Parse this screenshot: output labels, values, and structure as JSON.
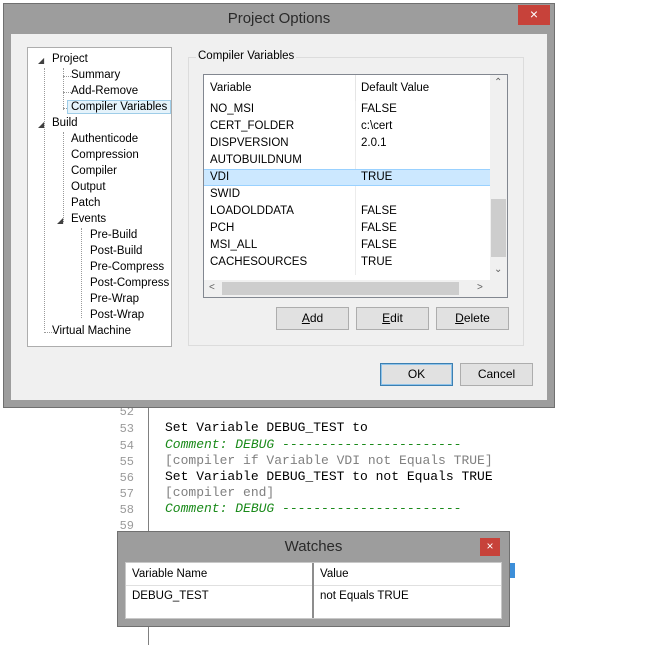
{
  "editor": {
    "lines": [
      {
        "num": "52",
        "text": ""
      },
      {
        "num": "53",
        "text": "Set Variable DEBUG_TEST to"
      },
      {
        "num": "54",
        "text": "Comment: DEBUG -----------------------"
      },
      {
        "num": "55",
        "text": "[compiler if Variable VDI not Equals TRUE]"
      },
      {
        "num": "56",
        "text": "Set Variable DEBUG_TEST to not Equals TRUE"
      },
      {
        "num": "57",
        "text": "[compiler end]"
      },
      {
        "num": "58",
        "text": "Comment: DEBUG -----------------------"
      },
      {
        "num": "59",
        "text": ""
      }
    ]
  },
  "project_options": {
    "title": "Project Options",
    "close_glyph": "×",
    "tree": {
      "project": "Project",
      "summary": "Summary",
      "add_remove": "Add-Remove",
      "compiler_variables": "Compiler Variables",
      "build": "Build",
      "authenticode": "Authenticode",
      "compression": "Compression",
      "compiler": "Compiler",
      "output": "Output",
      "patch": "Patch",
      "events": "Events",
      "pre_build": "Pre-Build",
      "post_build": "Post-Build",
      "pre_compress": "Pre-Compress",
      "post_compress": "Post-Compress",
      "pre_wrap": "Pre-Wrap",
      "post_wrap": "Post-Wrap",
      "virtual_machine": "Virtual Machine"
    },
    "group_label": "Compiler Variables",
    "columns": [
      "Variable",
      "Default Value"
    ],
    "rows": [
      {
        "variable": "NO_MSI",
        "value": "FALSE"
      },
      {
        "variable": "CERT_FOLDER",
        "value": "c:\\cert"
      },
      {
        "variable": "DISPVERSION",
        "value": "2.0.1"
      },
      {
        "variable": "AUTOBUILDNUM",
        "value": ""
      },
      {
        "variable": "VDI",
        "value": "TRUE"
      },
      {
        "variable": "SWID",
        "value": ""
      },
      {
        "variable": "LOADOLDDATA",
        "value": "FALSE"
      },
      {
        "variable": "PCH",
        "value": "FALSE"
      },
      {
        "variable": "MSI_ALL",
        "value": "FALSE"
      },
      {
        "variable": "CACHESOURCES",
        "value": "TRUE"
      }
    ],
    "selected_row": "VDI",
    "buttons": {
      "add": {
        "key": "A",
        "rest": "dd"
      },
      "edit": {
        "key": "E",
        "rest": "dit"
      },
      "delete": {
        "key": "D",
        "rest": "elete"
      },
      "ok": "OK",
      "cancel": "Cancel"
    }
  },
  "watches": {
    "title": "Watches",
    "close_glyph": "×",
    "columns": [
      "Variable Name",
      "Value"
    ],
    "rows": [
      {
        "name": "DEBUG_TEST",
        "value": "not Equals TRUE"
      }
    ]
  },
  "colors": {
    "close_red": "#c7423a",
    "selection": "#cce8ff",
    "comment_green": "#1a8a1a"
  }
}
